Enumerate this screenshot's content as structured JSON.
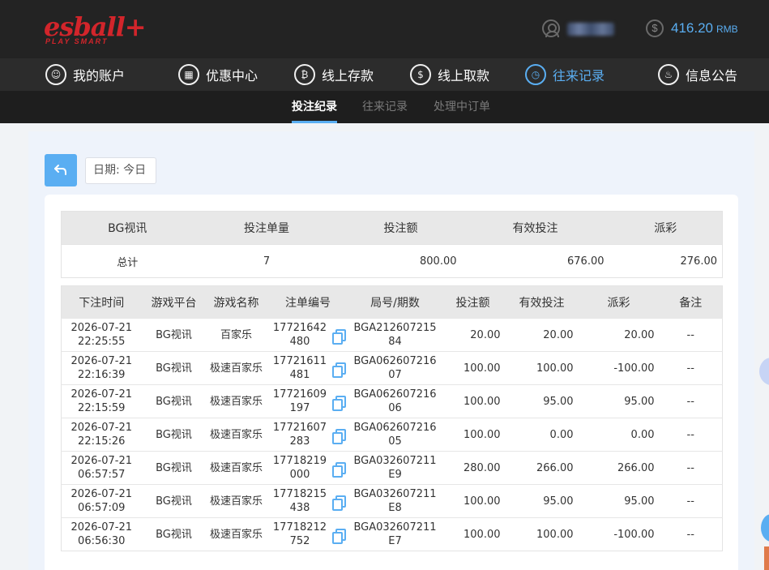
{
  "header": {
    "logo_text": "esball+",
    "logo_tagline": "PLAY SMART",
    "user_icon": "user-icon",
    "balance": "416.20",
    "currency": "RMB",
    "balance_icon": "dollar-coin-icon"
  },
  "mainnav": [
    {
      "label": "我的账户",
      "icon": "user-icon",
      "active": false
    },
    {
      "label": "优惠中心",
      "icon": "gift-icon",
      "active": false
    },
    {
      "label": "线上存款",
      "icon": "deposit-icon",
      "active": false
    },
    {
      "label": "线上取款",
      "icon": "withdraw-icon",
      "active": false
    },
    {
      "label": "往来记录",
      "icon": "record-icon",
      "active": true
    },
    {
      "label": "信息公告",
      "icon": "bell-icon",
      "active": false
    }
  ],
  "subnav": [
    {
      "label": "投注纪录",
      "active": true
    },
    {
      "label": "往来记录",
      "active": false
    },
    {
      "label": "处理中订单",
      "active": false
    }
  ],
  "filter": {
    "back_icon": "back-arrow-icon",
    "date_label": "日期: 今日"
  },
  "summary": {
    "headers": [
      "BG视讯",
      "投注单量",
      "投注额",
      "有效投注",
      "派彩"
    ],
    "row": [
      "总计",
      "7",
      "800.00",
      "676.00",
      "276.00"
    ]
  },
  "records": {
    "headers": [
      "下注时间",
      "游戏平台",
      "游戏名称",
      "注单编号",
      "局号/期数",
      "投注额",
      "有效投注",
      "派彩",
      "备注"
    ],
    "rows": [
      {
        "date": "2026-07-21",
        "time": "22:25:55",
        "platform": "BG视讯",
        "game": "百家乐",
        "no": "17721642480",
        "round": "BGA21260721584",
        "bet": "20.00",
        "valid": "20.00",
        "payout": "20.00",
        "payout_negative": false,
        "note": "--"
      },
      {
        "date": "2026-07-21",
        "time": "22:16:39",
        "platform": "BG视讯",
        "game": "极速百家乐",
        "no": "17721611481",
        "round": "BGA06260721607",
        "bet": "100.00",
        "valid": "100.00",
        "payout": "-100.00",
        "payout_negative": true,
        "note": "--"
      },
      {
        "date": "2026-07-21",
        "time": "22:15:59",
        "platform": "BG视讯",
        "game": "极速百家乐",
        "no": "17721609197",
        "round": "BGA06260721606",
        "bet": "100.00",
        "valid": "95.00",
        "payout": "95.00",
        "payout_negative": false,
        "note": "--"
      },
      {
        "date": "2026-07-21",
        "time": "22:15:26",
        "platform": "BG视讯",
        "game": "极速百家乐",
        "no": "17721607283",
        "round": "BGA06260721605",
        "bet": "100.00",
        "valid": "0.00",
        "payout": "0.00",
        "payout_negative": false,
        "note": "--"
      },
      {
        "date": "2026-07-21",
        "time": "06:57:57",
        "platform": "BG视讯",
        "game": "极速百家乐",
        "no": "17718219000",
        "round": "BGA032607211E9",
        "bet": "280.00",
        "valid": "266.00",
        "payout": "266.00",
        "payout_negative": false,
        "note": "--"
      },
      {
        "date": "2026-07-21",
        "time": "06:57:09",
        "platform": "BG视讯",
        "game": "极速百家乐",
        "no": "17718215438",
        "round": "BGA032607211E8",
        "bet": "100.00",
        "valid": "95.00",
        "payout": "95.00",
        "payout_negative": false,
        "note": "--"
      },
      {
        "date": "2026-07-21",
        "time": "06:56:30",
        "platform": "BG视讯",
        "game": "极速百家乐",
        "no": "17718212752",
        "round": "BGA032607211E7",
        "bet": "100.00",
        "valid": "100.00",
        "payout": "-100.00",
        "payout_negative": true,
        "note": "--"
      }
    ]
  }
}
